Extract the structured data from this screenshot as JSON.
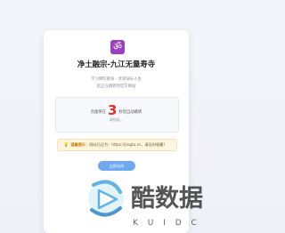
{
  "page": {
    "title": "净土融宗-九江无量寿寺",
    "subtitle_line1": "学习佛陀教育 · 享受快乐人生",
    "subtitle_line2": "您正在跳转到官方网站"
  },
  "redirect": {
    "prefix": "页面将在",
    "countdown": "3",
    "suffix": "秒后自动跳转",
    "wait_text": "请稍候..."
  },
  "tip": {
    "label": "温馨提示：",
    "text": "网站已迁为：https://jingtu.cc，请及时收藏！"
  },
  "button": {
    "label": "立即访问"
  },
  "watermark": {
    "brand": "酷数据",
    "sub": "K U I D C"
  },
  "colors": {
    "logo": "#9b3fc2",
    "countdown": "#e0302a",
    "button": "#6fa8f0",
    "tip_bg": "#fdf5e0"
  },
  "icons": {
    "logo": "om-icon",
    "tip": "lightbulb-icon"
  }
}
